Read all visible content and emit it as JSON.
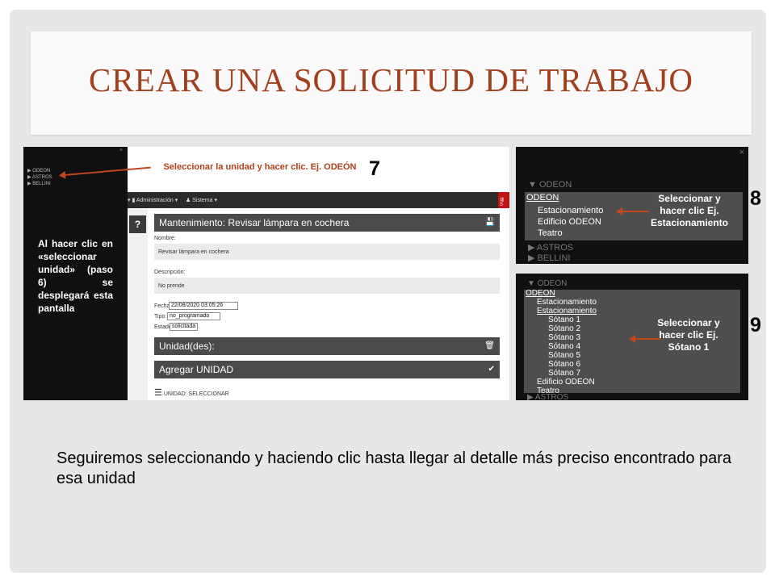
{
  "slide": {
    "title": "CREAR UNA SOLICITUD DE TRABAJO",
    "bottom_text": "Seguiremos seleccionando y haciendo clic hasta llegar al detalle más preciso encontrado para esa unidad"
  },
  "left": {
    "sidebar_tree": [
      "▶ ODEON",
      "▶ ASTROS",
      "▶ BELLINI"
    ],
    "sidebar_close": "×",
    "sidebar_note": "Al hacer clic en «seleccionar unidad» (paso 6) se desplegará esta pantalla",
    "callout": "Seleccionar la unidad y hacer clic. Ej. ODEÓN",
    "step": "7",
    "nav": {
      "admin": "▾  ▮ Administración ▾",
      "system": "♟ Sistema ▾",
      "right": "⇶ S"
    },
    "help": "?",
    "header": "Mantenimiento: Revisar lámpara en cochera",
    "save_icon": "💾",
    "nombre_label": "Nombre:",
    "nombre_value": "Revisar lámpara en cochera",
    "descripcion_label": "Descripción:",
    "descripcion_value": "No prende",
    "fecha_label": "Fecha:",
    "fecha_value": "22/08/2020 03:05:26",
    "tipo_label": "Tipo:",
    "tipo_value": "no_programado",
    "estado_label": "Estado:",
    "estado_value": "solicitada",
    "unidades": "Unidad(des):",
    "trash_icon": "🗑",
    "agregar": "Agregar UNIDAD",
    "check_icon": "✔",
    "menu_icon": "☰",
    "unidad_sel": "UNIDAD: SELECCIONAR"
  },
  "panel8": {
    "step": "8",
    "close": "×",
    "odeon_dim": "▼ ODEON",
    "odeon": "ODEON",
    "items": [
      "Estacionamiento",
      "Edificio ODEON",
      "Teatro"
    ],
    "astros": "▶ ASTROS",
    "bellini": "▶ BELLINI",
    "callout": "Seleccionar y hacer clic Ej. Estacionamiento"
  },
  "panel9": {
    "step": "9",
    "odeon_dim": "▼ ODEON",
    "odeon": "ODEON",
    "estacionamiento": "Estacionamiento",
    "estacionamiento2": "Estacionamiento",
    "sotanos": [
      "Sótano 1",
      "Sótano 2",
      "Sótano 3",
      "Sótano 4",
      "Sótano 5",
      "Sótano 6",
      "Sótano 7"
    ],
    "edificio": "Edificio ODEON",
    "teatro": "Teatro",
    "astros": "▶ ASTROS",
    "callout": "Seleccionar y hacer clic Ej. Sótano 1"
  },
  "colors": {
    "title": "#a2401e",
    "arrow": "#c0471e",
    "callout_red": "#b0401a"
  }
}
